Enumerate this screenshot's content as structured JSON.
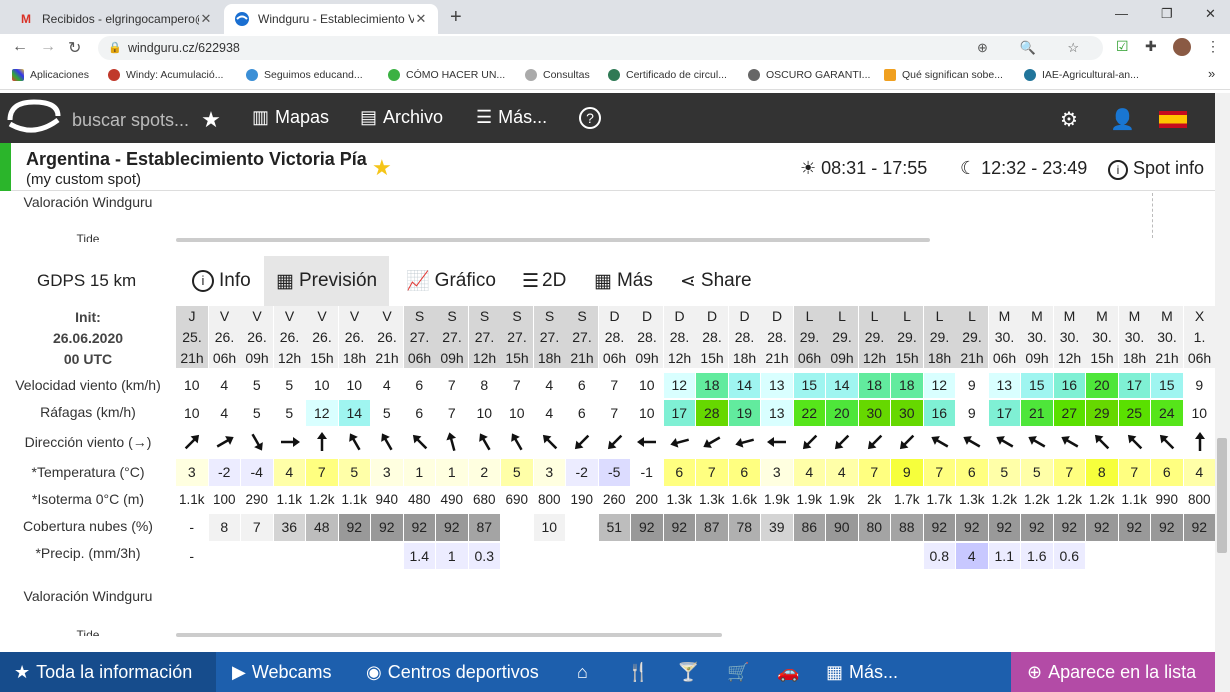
{
  "browser": {
    "tabs": [
      {
        "title": "Recibidos - elgringocampero@gmail.com",
        "icon": "gmail-icon"
      },
      {
        "title": "Windguru - Establecimiento Victoria Pía",
        "icon": "windguru-icon"
      }
    ],
    "url": "windguru.cz/622938",
    "bookmarks": [
      "Aplicaciones",
      "Windy: Acumulació...",
      "Seguimos educand...",
      "CÓMO HACER UN...",
      "Consultas",
      "Certificado de circul...",
      "OSCURO GARANTI...",
      "Qué significan sobe...",
      "IAE-Agricultural-an..."
    ]
  },
  "site": {
    "search": "buscar spots...",
    "mapas": "Mapas",
    "archivo": "Archivo",
    "mas": "Más...",
    "help": "?"
  },
  "spot": {
    "name": "Argentina - Establecimiento Victoria Pía",
    "sub": "(my custom spot)",
    "sun": "08:31 - 17:55",
    "moon": "12:32 - 23:49",
    "info": "Spot info"
  },
  "top_labels": {
    "rating": "Valoración Windguru",
    "tide": "Tide"
  },
  "model_tabs": {
    "model": "GDPS 15 km",
    "info": "Info",
    "prevision": "Previsión",
    "grafico": "Gráfico",
    "d2": "2D",
    "mas": "Más",
    "share": "Share"
  },
  "init": {
    "label": "Init:",
    "date": "26.06.2020",
    "time": "00 UTC"
  },
  "labels": {
    "speed": "Velocidad viento (km/h)",
    "gusts": "Ráfagas (km/h)",
    "dir": "Dirección viento (→)",
    "temp": "*Temperatura (°C)",
    "iso": "*Isoterma 0°C (m)",
    "cloud": "Cobertura nubes (%)",
    "precip": "*Precip. (mm/3h)",
    "rating": "Valoración Windguru",
    "tide": "Tide"
  },
  "columns": [
    {
      "d": "J",
      "dt": "25.",
      "h": "21h"
    },
    {
      "d": "V",
      "dt": "26.",
      "h": "06h"
    },
    {
      "d": "V",
      "dt": "26.",
      "h": "09h"
    },
    {
      "d": "V",
      "dt": "26.",
      "h": "12h"
    },
    {
      "d": "V",
      "dt": "26.",
      "h": "15h"
    },
    {
      "d": "V",
      "dt": "26.",
      "h": "18h"
    },
    {
      "d": "V",
      "dt": "26.",
      "h": "21h"
    },
    {
      "d": "S",
      "dt": "27.",
      "h": "06h"
    },
    {
      "d": "S",
      "dt": "27.",
      "h": "09h"
    },
    {
      "d": "S",
      "dt": "27.",
      "h": "12h"
    },
    {
      "d": "S",
      "dt": "27.",
      "h": "15h"
    },
    {
      "d": "S",
      "dt": "27.",
      "h": "18h"
    },
    {
      "d": "S",
      "dt": "27.",
      "h": "21h"
    },
    {
      "d": "D",
      "dt": "28.",
      "h": "06h"
    },
    {
      "d": "D",
      "dt": "28.",
      "h": "09h"
    },
    {
      "d": "D",
      "dt": "28.",
      "h": "12h"
    },
    {
      "d": "D",
      "dt": "28.",
      "h": "15h"
    },
    {
      "d": "D",
      "dt": "28.",
      "h": "18h"
    },
    {
      "d": "D",
      "dt": "28.",
      "h": "21h"
    },
    {
      "d": "L",
      "dt": "29.",
      "h": "06h"
    },
    {
      "d": "L",
      "dt": "29.",
      "h": "09h"
    },
    {
      "d": "L",
      "dt": "29.",
      "h": "12h"
    },
    {
      "d": "L",
      "dt": "29.",
      "h": "15h"
    },
    {
      "d": "L",
      "dt": "29.",
      "h": "18h"
    },
    {
      "d": "L",
      "dt": "29.",
      "h": "21h"
    },
    {
      "d": "M",
      "dt": "30.",
      "h": "06h"
    },
    {
      "d": "M",
      "dt": "30.",
      "h": "09h"
    },
    {
      "d": "M",
      "dt": "30.",
      "h": "12h"
    },
    {
      "d": "M",
      "dt": "30.",
      "h": "15h"
    },
    {
      "d": "M",
      "dt": "30.",
      "h": "18h"
    },
    {
      "d": "M",
      "dt": "30.",
      "h": "21h"
    },
    {
      "d": "X",
      "dt": "1.",
      "h": "06h"
    }
  ],
  "speed": [
    "10",
    "4",
    "5",
    "5",
    "10",
    "10",
    "4",
    "6",
    "7",
    "8",
    "7",
    "4",
    "6",
    "7",
    "10",
    "12",
    "18",
    "14",
    "13",
    "15",
    "14",
    "18",
    "18",
    "12",
    "9",
    "13",
    "15",
    "16",
    "20",
    "17",
    "15",
    "9"
  ],
  "gusts": [
    "10",
    "4",
    "5",
    "5",
    "12",
    "14",
    "5",
    "6",
    "7",
    "10",
    "10",
    "4",
    "6",
    "7",
    "10",
    "17",
    "28",
    "19",
    "13",
    "22",
    "20",
    "30",
    "30",
    "16",
    "9",
    "17",
    "21",
    "27",
    "29",
    "25",
    "24",
    "10"
  ],
  "dir_deg": [
    45,
    60,
    150,
    90,
    0,
    330,
    330,
    315,
    345,
    330,
    330,
    315,
    225,
    225,
    270,
    255,
    240,
    255,
    270,
    225,
    225,
    225,
    225,
    300,
    300,
    300,
    300,
    300,
    315,
    315,
    315,
    0
  ],
  "temp": [
    "3",
    "-2",
    "-4",
    "4",
    "7",
    "5",
    "3",
    "1",
    "1",
    "2",
    "5",
    "3",
    "-2",
    "-5",
    "-1",
    "6",
    "7",
    "6",
    "3",
    "4",
    "4",
    "7",
    "9",
    "7",
    "6",
    "5",
    "5",
    "7",
    "8",
    "7",
    "6",
    "4"
  ],
  "iso": [
    "1.1k",
    "100",
    "290",
    "1.1k",
    "1.2k",
    "1.1k",
    "940",
    "480",
    "490",
    "680",
    "690",
    "800",
    "190",
    "260",
    "200",
    "1.3k",
    "1.3k",
    "1.6k",
    "1.9k",
    "1.9k",
    "1.9k",
    "2k",
    "1.7k",
    "1.7k",
    "1.3k",
    "1.2k",
    "1.2k",
    "1.2k",
    "1.2k",
    "1.1k",
    "990",
    "800"
  ],
  "cloud": [
    "-",
    "8",
    "7",
    "36",
    "48",
    "92",
    "92",
    "92",
    "92",
    "87",
    "",
    "10",
    "",
    "51",
    "92",
    "92",
    "87",
    "78",
    "39",
    "86",
    "90",
    "80",
    "88",
    "92",
    "92",
    "92",
    "92",
    "92",
    "92",
    "92",
    "92",
    "92"
  ],
  "precip": [
    "-",
    "",
    "",
    "",
    "",
    "",
    "",
    "1.4",
    "1",
    "0.3",
    "",
    "",
    "",
    "",
    "",
    "",
    "",
    "",
    "",
    "",
    "",
    "",
    "",
    "0.8",
    "4",
    "1.1",
    "1.6",
    "0.6",
    "",
    "",
    "",
    ""
  ],
  "bottom": {
    "all": "Toda la información",
    "webcams": "Webcams",
    "centros": "Centros deportivos",
    "mas": "Más...",
    "lista": "Aparece en la lista"
  }
}
